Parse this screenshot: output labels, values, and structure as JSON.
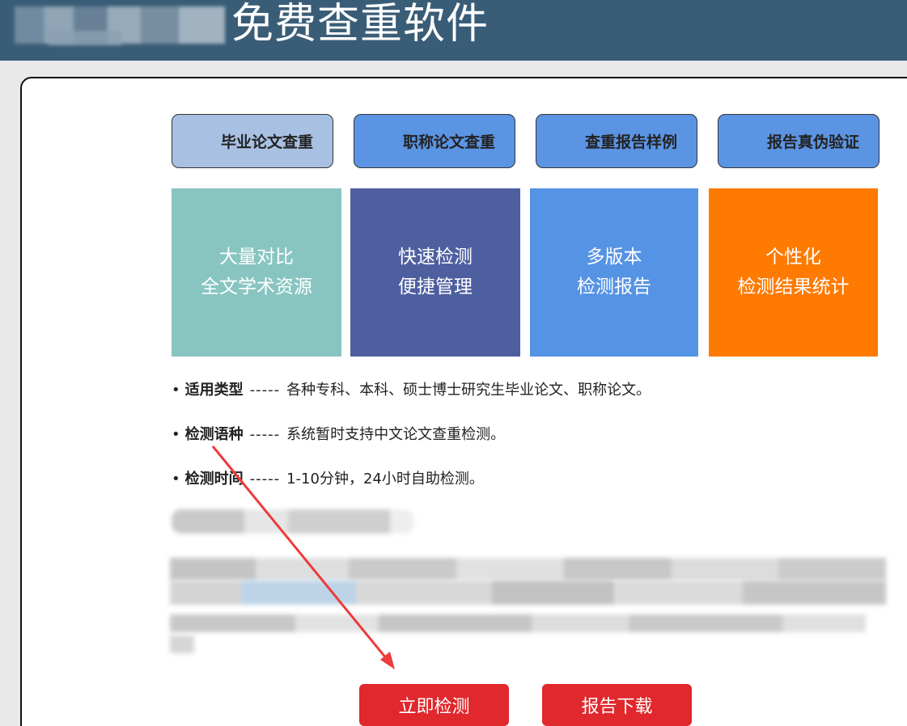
{
  "header": {
    "title": "免费查重软件"
  },
  "tabs": [
    {
      "label": "毕业论文查重",
      "active": true
    },
    {
      "label": "职称论文查重",
      "active": false
    },
    {
      "label": "查重报告样例",
      "active": false
    },
    {
      "label": "报告真伪验证",
      "active": false
    }
  ],
  "features": [
    {
      "line1": "大量对比",
      "line2": "全文学术资源",
      "color": "#88c5c1"
    },
    {
      "line1": "快速检测",
      "line2": "便捷管理",
      "color": "#4e5fa0"
    },
    {
      "line1": "多版本",
      "line2": "检测报告",
      "color": "#5593e4"
    },
    {
      "line1": "个性化",
      "line2": "检测结果统计",
      "color": "#fe7a00"
    }
  ],
  "info": [
    {
      "bullet": "•",
      "label": "适用类型",
      "sep": "-----",
      "text": "各种专科、本科、硕士博士研究生毕业论文、职称论文。"
    },
    {
      "bullet": "•",
      "label": "检测语种",
      "sep": "-----",
      "text": "系统暂时支持中文论文查重检测。"
    },
    {
      "bullet": "•",
      "label": "检测时间",
      "sep": "-----",
      "text": "1-10分钟，24小时自助检测。"
    }
  ],
  "buttons": {
    "check": "立即检测",
    "download": "报告下载"
  },
  "colors": {
    "header_bg": "#3a5d77",
    "tab_active": "#a8c1e3",
    "tab_normal": "#5b94e3",
    "button_red": "#e0282d",
    "arrow_red": "#ee3b3b"
  }
}
